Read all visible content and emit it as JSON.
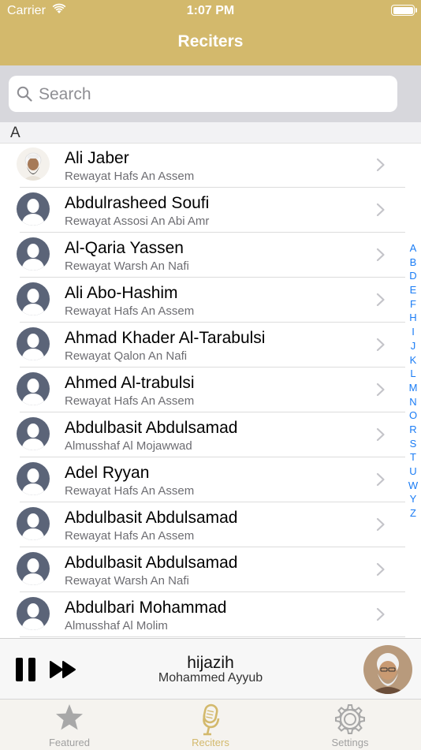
{
  "status": {
    "carrier": "Carrier",
    "time": "1:07 PM"
  },
  "nav": {
    "title": "Reciters"
  },
  "search": {
    "placeholder": "Search"
  },
  "section": {
    "letter": "A"
  },
  "reciters": [
    {
      "name": "Ali Jaber",
      "riwaya": "Rewayat Hafs An Assem",
      "photo": true
    },
    {
      "name": "Abdulrasheed Soufi",
      "riwaya": "Rewayat Assosi An Abi Amr",
      "photo": false
    },
    {
      "name": "Al-Qaria Yassen",
      "riwaya": "Rewayat Warsh An Nafi",
      "photo": false
    },
    {
      "name": "Ali Abo-Hashim",
      "riwaya": "Rewayat Hafs An Assem",
      "photo": false
    },
    {
      "name": "Ahmad Khader Al-Tarabulsi",
      "riwaya": "Rewayat Qalon An Nafi",
      "photo": false
    },
    {
      "name": "Ahmed Al-trabulsi",
      "riwaya": "Rewayat Hafs An Assem",
      "photo": false
    },
    {
      "name": "Abdulbasit Abdulsamad",
      "riwaya": "Almusshaf Al Mojawwad",
      "photo": false
    },
    {
      "name": "Adel Ryyan",
      "riwaya": "Rewayat Hafs An Assem",
      "photo": false
    },
    {
      "name": "Abdulbasit Abdulsamad",
      "riwaya": "Rewayat Hafs An Assem",
      "photo": false
    },
    {
      "name": "Abdulbasit Abdulsamad",
      "riwaya": "Rewayat Warsh An Nafi",
      "photo": false
    },
    {
      "name": "Abdulbari Mohammad",
      "riwaya": "Almusshaf Al Molim",
      "photo": false
    }
  ],
  "index_letters": [
    "A",
    "B",
    "D",
    "E",
    "F",
    "H",
    "I",
    "J",
    "K",
    "L",
    "M",
    "N",
    "O",
    "R",
    "S",
    "T",
    "U",
    "W",
    "Y",
    "Z"
  ],
  "player": {
    "track": "hijazih",
    "artist": "Mohammed Ayyub"
  },
  "tabs": [
    {
      "label": "Featured",
      "icon": "star-icon",
      "active": false
    },
    {
      "label": "Reciters",
      "icon": "microphone-icon",
      "active": true
    },
    {
      "label": "Settings",
      "icon": "gear-icon",
      "active": false
    }
  ],
  "colors": {
    "accent": "#d3b96c",
    "index": "#1a7cf5",
    "placeholder_avatar": "#5b6478"
  }
}
